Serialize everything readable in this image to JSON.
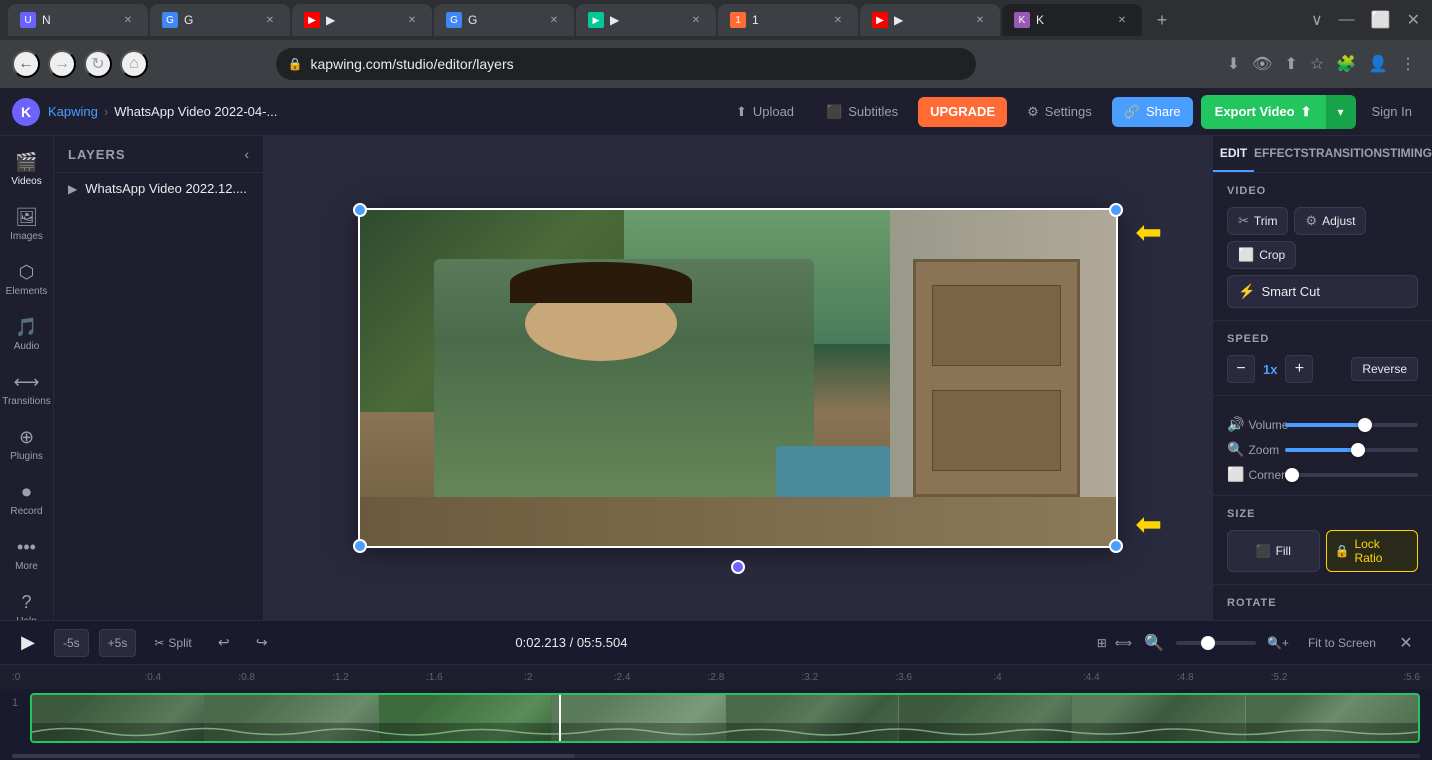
{
  "browser": {
    "tabs": [
      {
        "id": 1,
        "favicon_color": "#6c63ff",
        "favicon_letter": "U",
        "title": "N",
        "active": false
      },
      {
        "id": 2,
        "favicon_color": "#4285f4",
        "favicon_letter": "G",
        "title": "G",
        "active": false
      },
      {
        "id": 3,
        "favicon_color": "#ff0000",
        "favicon_letter": "▶",
        "title": "▶",
        "active": false
      },
      {
        "id": 4,
        "favicon_color": "#4285f4",
        "favicon_letter": "G",
        "title": "G",
        "active": false
      },
      {
        "id": 5,
        "favicon_color": "#00c896",
        "favicon_letter": "▶",
        "title": "▶",
        "active": false
      },
      {
        "id": 6,
        "favicon_color": "#ff6b35",
        "favicon_letter": "1",
        "title": "1",
        "active": false
      },
      {
        "id": 7,
        "favicon_color": "#ff0000",
        "favicon_letter": "▶",
        "title": "▶",
        "active": false
      },
      {
        "id": 8,
        "favicon_color": "#9b59b6",
        "favicon_letter": "K",
        "title": "K",
        "active": true
      }
    ],
    "address": "kapwing.com/studio/editor/layers",
    "new_tab_label": "+"
  },
  "app": {
    "logo_letter": "K",
    "breadcrumb_link": "Kapwing",
    "breadcrumb_sep": "›",
    "breadcrumb_current": "WhatsApp Video 2022-04-...",
    "header_buttons": {
      "upload": "⬆ Upload",
      "subtitles": "⬛ Subtitles",
      "upgrade": "UPGRADE",
      "settings": "⚙ Settings",
      "share": "🔗 Share",
      "export": "Export Video ⬆",
      "export_dropdown": "▾",
      "sign_in": "Sign In"
    }
  },
  "sidebar": {
    "items": [
      {
        "id": "videos",
        "icon": "🎬",
        "label": "Videos"
      },
      {
        "id": "images",
        "icon": "🖼",
        "label": "Images"
      },
      {
        "id": "elements",
        "icon": "⬡",
        "label": "Elements"
      },
      {
        "id": "audio",
        "icon": "🎵",
        "label": "Audio"
      },
      {
        "id": "transitions",
        "icon": "⟷",
        "label": "Transitions"
      },
      {
        "id": "plugins",
        "icon": "⊕",
        "label": "Plugins"
      },
      {
        "id": "record",
        "icon": "⏺",
        "label": "Record"
      },
      {
        "id": "more",
        "icon": "•••",
        "label": "More"
      },
      {
        "id": "help",
        "icon": "?",
        "label": "Help"
      }
    ]
  },
  "layers": {
    "title": "LAYERS",
    "collapse_icon": "‹",
    "items": [
      {
        "id": 1,
        "icon": "▶",
        "name": "WhatsApp Video 2022.12...."
      }
    ]
  },
  "right_panel": {
    "tabs": [
      {
        "id": "edit",
        "label": "EDIT",
        "active": true
      },
      {
        "id": "effects",
        "label": "EFFECTS",
        "active": false
      },
      {
        "id": "transitions",
        "label": "TRANSITIONS",
        "active": false
      },
      {
        "id": "timing",
        "label": "TIMING",
        "active": false
      }
    ],
    "video_section": {
      "label": "VIDEO",
      "buttons": [
        {
          "id": "trim",
          "icon": "✂",
          "label": "Trim"
        },
        {
          "id": "adjust",
          "icon": "⚙",
          "label": "Adjust"
        },
        {
          "id": "crop",
          "icon": "⬜",
          "label": "Crop"
        }
      ],
      "smart_cut": {
        "icon": "⚡",
        "label": "Smart Cut"
      }
    },
    "speed_section": {
      "label": "SPEED",
      "decrease_icon": "−",
      "speed_value": "1x",
      "increase_icon": "+",
      "reverse_label": "Reverse"
    },
    "sliders": [
      {
        "id": "volume",
        "icon": "🔊",
        "label": "Volume",
        "fill_pct": 60,
        "thumb_pct": 60
      },
      {
        "id": "zoom",
        "icon": "🔍",
        "label": "Zoom",
        "fill_pct": 55,
        "thumb_pct": 55
      },
      {
        "id": "corners",
        "icon": "⬜",
        "label": "Corners",
        "fill_pct": 5,
        "thumb_pct": 5
      }
    ],
    "size_section": {
      "label": "SIZE",
      "fill_btn": {
        "icon": "⬛",
        "label": "Fill",
        "active": false
      },
      "lock_ratio_btn": {
        "icon": "🔒",
        "label": "Lock Ratio",
        "active": true
      }
    },
    "rotate_section": {
      "label": "ROTATE"
    }
  },
  "timeline": {
    "play_icon": "▶",
    "skip_back": "-5s",
    "skip_forward": "+5s",
    "split": "Split",
    "undo_icon": "↩",
    "redo_icon": "↪",
    "time_display": "0:02.213 / 05:5.504",
    "zoom_out_icon": "🔍",
    "zoom_in_icon": "🔍",
    "fit_screen": "Fit to Screen",
    "close_icon": "✕",
    "ruler_marks": [
      ":0",
      ":0.4",
      ":0.8",
      ":1.2",
      ":1.6",
      ":2",
      ":2.4",
      ":2.8",
      ":3.2",
      ":3.6",
      ":4",
      ":4.4",
      ":4.8",
      ":5.2",
      ":5.6"
    ],
    "track_number": "1"
  },
  "colors": {
    "accent_blue": "#4a9eff",
    "accent_green": "#22c55e",
    "accent_yellow": "#ffd700",
    "accent_red": "#ff6b35",
    "bg_dark": "#1e1e2e",
    "bg_darker": "#1a1a2e",
    "border": "#2a2a3e",
    "text_primary": "#e8eaed",
    "text_secondary": "#9aa0a6",
    "lock_ratio_border": "#ffd700"
  }
}
